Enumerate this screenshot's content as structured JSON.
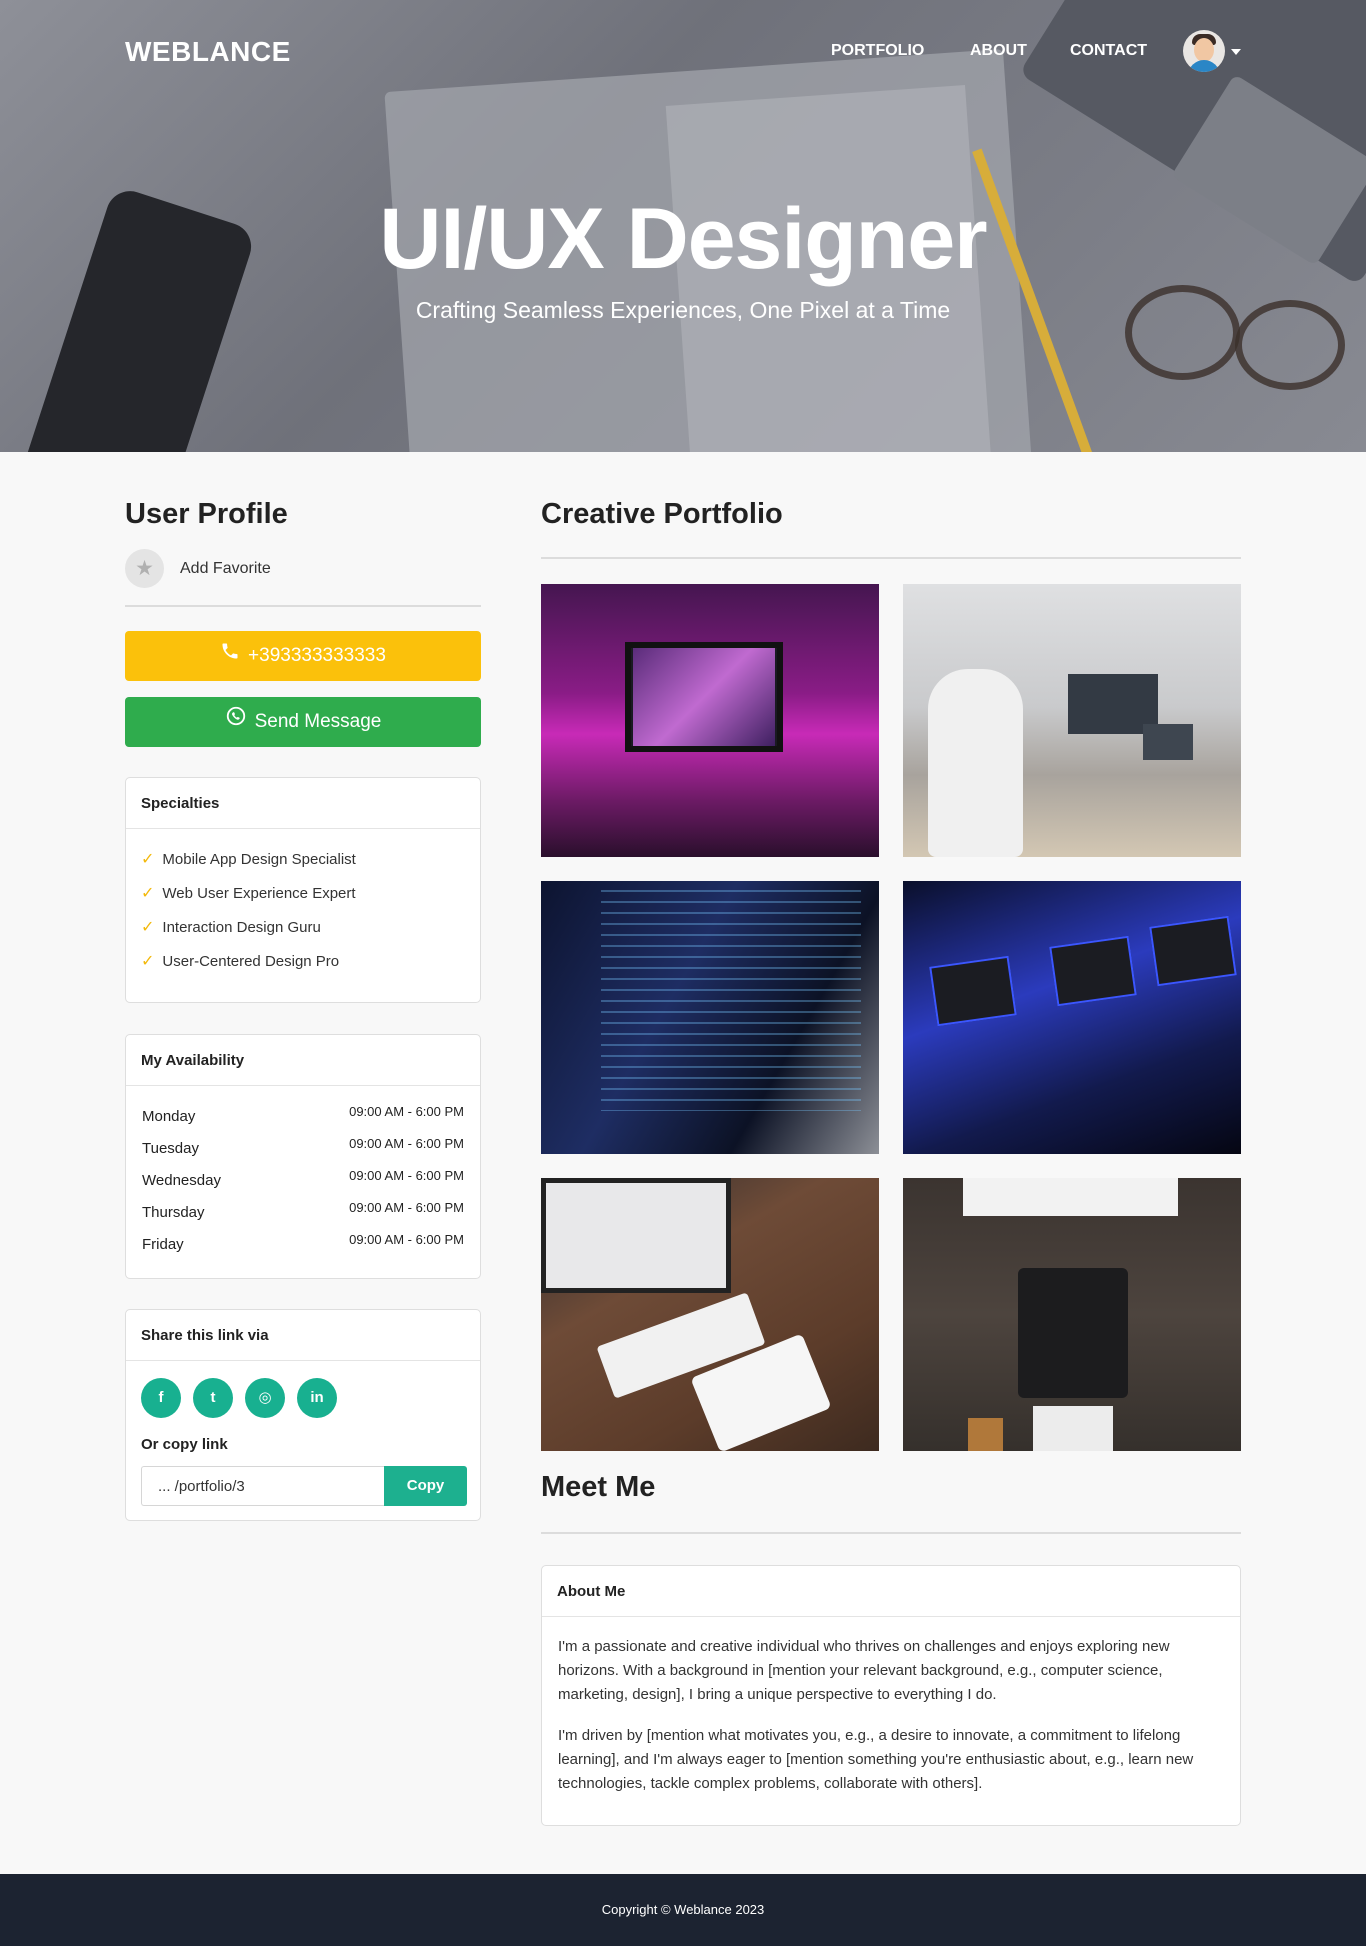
{
  "header": {
    "brand": "WEBLANCE",
    "nav": [
      "PORTFOLIO",
      "ABOUT",
      "CONTACT"
    ],
    "avatar_icon": "user-avatar-icon"
  },
  "hero": {
    "title": "UI/UX Designer",
    "subtitle": "Crafting Seamless Experiences, One Pixel at a Time"
  },
  "profile": {
    "title": "User Profile",
    "favorite_label": "Add Favorite",
    "favorite_icon": "star-icon",
    "phone_label": "+393333333333",
    "phone_icon": "phone-icon",
    "message_label": "Send Message",
    "message_icon": "whatsapp-icon",
    "phone_color": "#fbc10b",
    "message_color": "#2fac4d"
  },
  "specialties": {
    "title": "Specialties",
    "items": [
      "Mobile App Design Specialist",
      "Web User Experience Expert",
      "Interaction Design Guru",
      "User-Centered Design Pro"
    ]
  },
  "availability": {
    "title": "My Availability",
    "rows": [
      {
        "day": "Monday",
        "time": "09:00 AM - 6:00 PM"
      },
      {
        "day": "Tuesday",
        "time": "09:00 AM - 6:00 PM"
      },
      {
        "day": "Wednesday",
        "time": "09:00 AM - 6:00 PM"
      },
      {
        "day": "Thursday",
        "time": "09:00 AM - 6:00 PM"
      },
      {
        "day": "Friday",
        "time": "09:00 AM - 6:00 PM"
      }
    ]
  },
  "share": {
    "title": "Share this link via",
    "icons": [
      "facebook-icon",
      "twitter-icon",
      "instagram-icon",
      "linkedin-icon"
    ],
    "copy_label": "Or copy link",
    "link_value": "... /portfolio/3",
    "copy_button": "Copy",
    "accent": "#1db08f"
  },
  "portfolio": {
    "title": "Creative Portfolio"
  },
  "meet": {
    "title": "Meet Me",
    "card_title": "About Me",
    "paragraphs": [
      "I'm a passionate and creative individual who thrives on challenges and enjoys exploring new horizons. With a background in [mention your relevant background, e.g., computer science, marketing, design], I bring a unique perspective to everything I do.",
      "I'm driven by [mention what motivates you, e.g., a desire to innovate, a commitment to lifelong learning], and I'm always eager to [mention something you're enthusiastic about, e.g., learn new technologies, tackle complex problems, collaborate with others]."
    ]
  },
  "footer": {
    "copyright": "Copyright © Weblance 2023",
    "background": "#1c2331"
  }
}
